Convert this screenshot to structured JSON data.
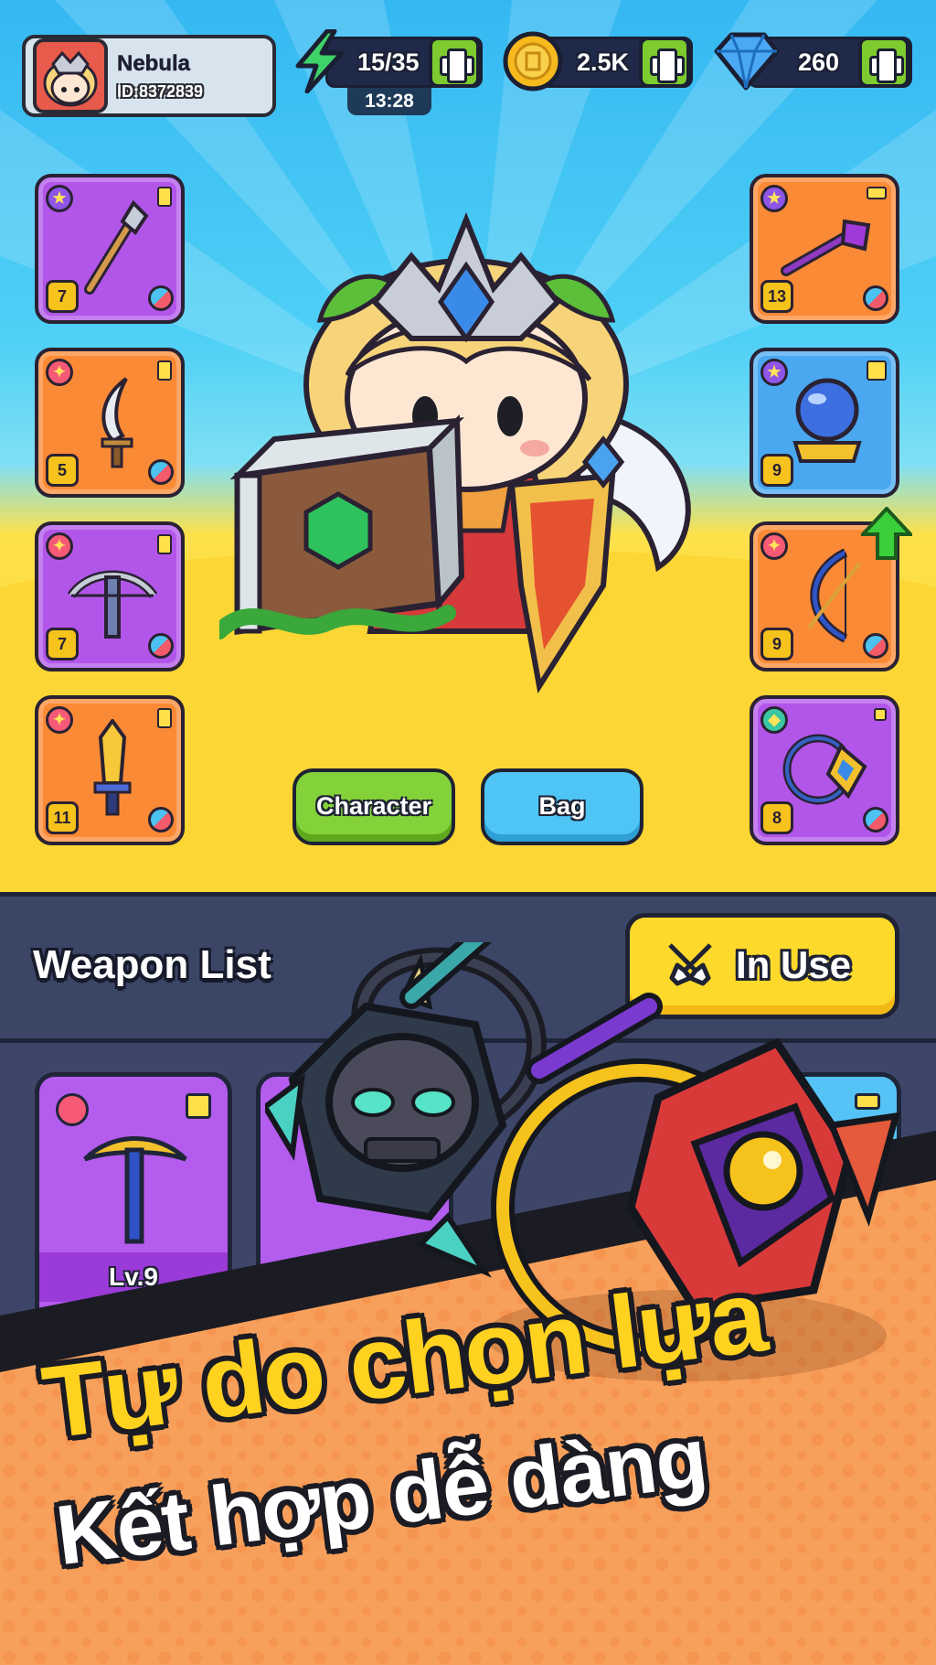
{
  "header": {
    "player_name": "Nebula",
    "player_id": "ID:8372839",
    "energy": "15/35",
    "energy_timer": "13:28",
    "gold": "2.5K",
    "gems": "260"
  },
  "left_slots": [
    {
      "level": "7",
      "tag": "star",
      "weapon": "staff-icon"
    },
    {
      "level": "5",
      "tag": "fire",
      "weapon": "dagger-icon"
    },
    {
      "level": "7",
      "tag": "fire",
      "weapon": "crossbow-icon"
    },
    {
      "level": "11",
      "tag": "fire",
      "weapon": "sword-icon"
    }
  ],
  "right_slots": [
    {
      "level": "13",
      "tag": "star",
      "weapon": "scepter-icon"
    },
    {
      "level": "9",
      "tag": "star",
      "weapon": "crystal-ball-icon"
    },
    {
      "level": "9",
      "tag": "fire",
      "weapon": "bow-icon"
    },
    {
      "level": "8",
      "tag": "shield",
      "weapon": "amulet-icon"
    }
  ],
  "buttons": {
    "character": "Character",
    "bag": "Bag",
    "in_use": "In Use"
  },
  "weapon_list": {
    "title": "Weapon List",
    "cards": [
      {
        "level": "Lv.9",
        "weapon": "pickaxe-icon"
      }
    ]
  },
  "banner": {
    "line1": "Tự do chọn lựa",
    "line2": "Kết hợp dễ dàng"
  },
  "colors": {
    "sky": "#35b8f2",
    "ground": "#fcd634",
    "purple_slot": "#b256ea",
    "orange_slot": "#fb8a36",
    "accent_yellow": "#ffd21f",
    "banner_orange": "#f7a05c"
  }
}
